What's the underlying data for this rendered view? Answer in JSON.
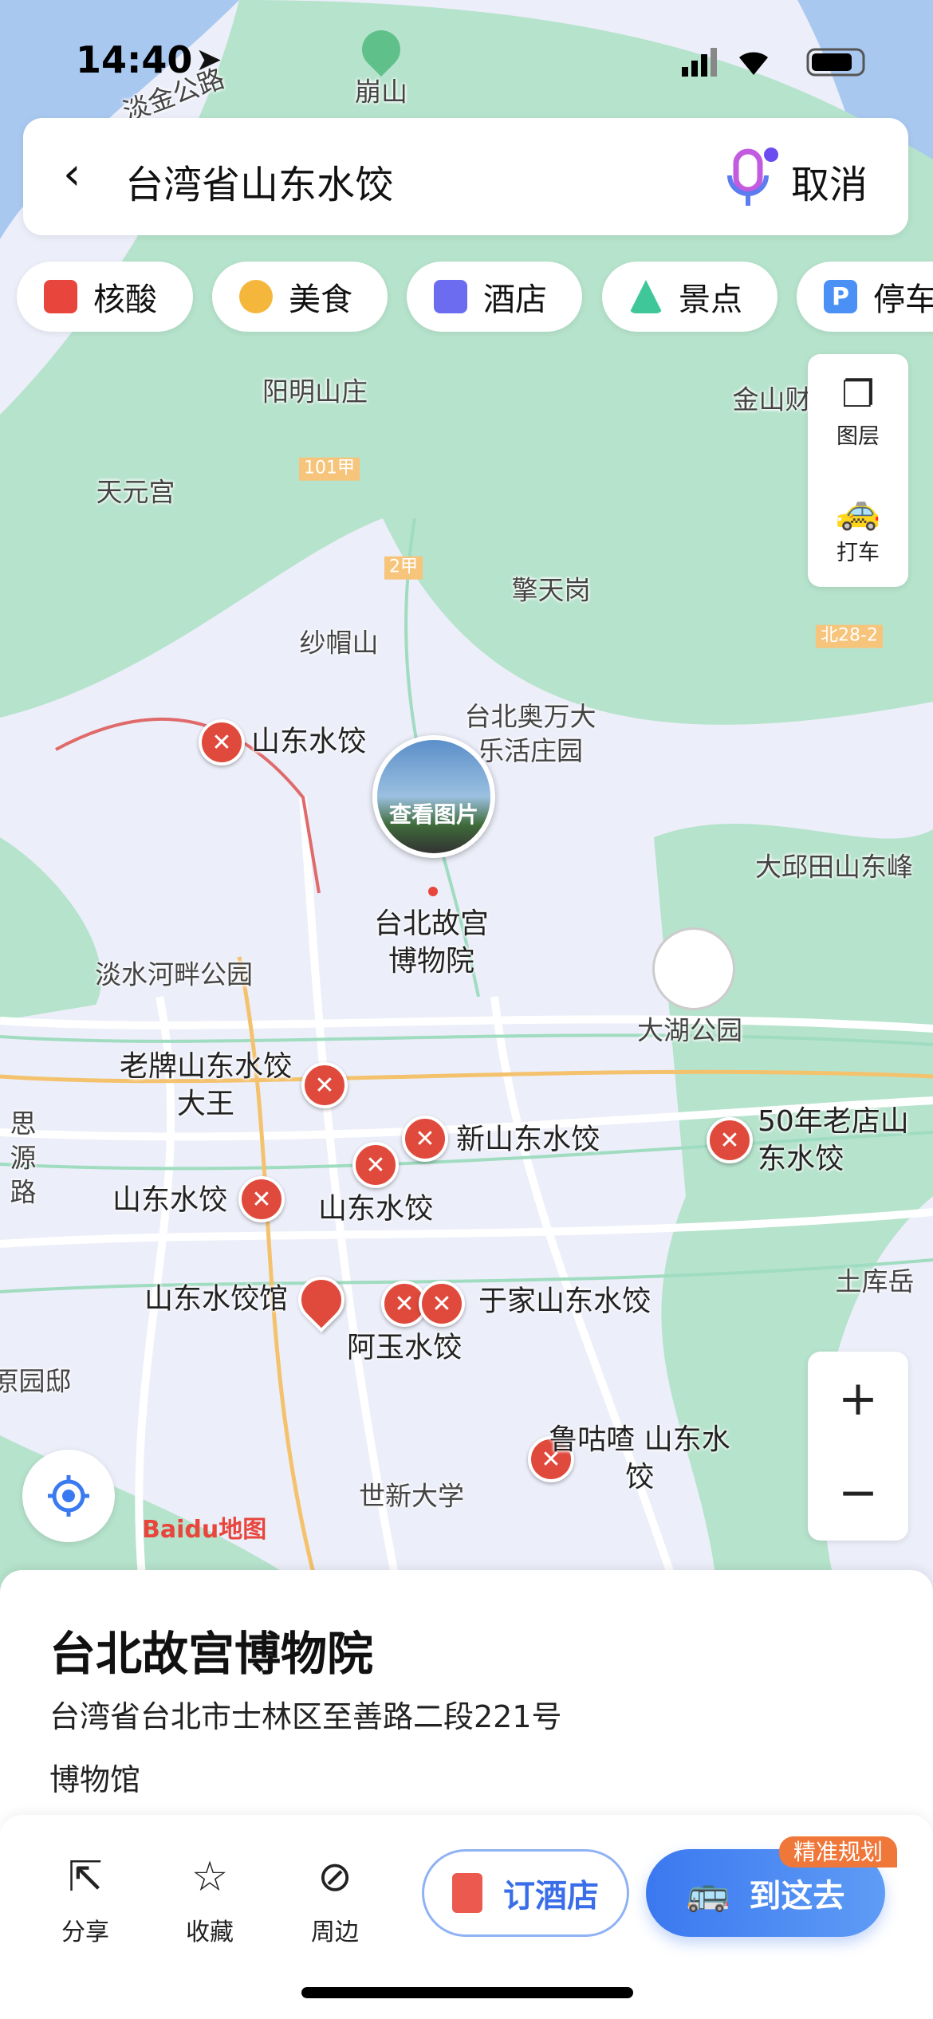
{
  "status_bar": {
    "time": "14:40"
  },
  "search": {
    "query": "台湾省山东水饺",
    "cancel": "取消"
  },
  "chips": [
    {
      "label": "核酸",
      "color": "#e8453c",
      "icon": "test-tube-icon"
    },
    {
      "label": "美食",
      "color": "#f5b73b",
      "icon": "food-icon"
    },
    {
      "label": "酒店",
      "color": "#6b6cf0",
      "icon": "hotel-icon"
    },
    {
      "label": "景点",
      "color": "#3fc79a",
      "icon": "scenic-icon"
    },
    {
      "label": "停车",
      "color": "#4a90f5",
      "icon": "parking-icon"
    }
  ],
  "side_panel": {
    "layers": "图层",
    "taxi": "打车"
  },
  "map": {
    "places": [
      "崩山",
      "阳明山庄",
      "天元宫",
      "擎天岗",
      "纱帽山",
      "台北奥万大乐活庄园",
      "金山财",
      "大邱田山东峰",
      "淡水河畔公园",
      "大湖公园",
      "土库岳",
      "世新大学",
      "思源路",
      "原园邸"
    ],
    "roads": [
      "101甲",
      "2甲",
      "北28-2",
      "淡金公路"
    ],
    "selected": {
      "name": "台北故宫博物院",
      "photo_label": "查看图片"
    },
    "results": [
      "山东水饺",
      "老牌山东水饺大王",
      "新山东水饺",
      "山东水饺",
      "山东水饺",
      "50年老店山东水饺",
      "山东水饺馆",
      "于家山东水饺",
      "阿玉水饺",
      "鲁咕喳 山东水饺"
    ],
    "logo": "Baidu地图"
  },
  "poi": {
    "title": "台北故宫博物院",
    "address": "台湾省台北市士林区至善路二段221号",
    "category": "博物馆"
  },
  "actions": {
    "share": "分享",
    "favorite": "收藏",
    "nearby": "周边",
    "hotel": "订酒店",
    "go": "到这去",
    "go_badge": "精准规划"
  }
}
